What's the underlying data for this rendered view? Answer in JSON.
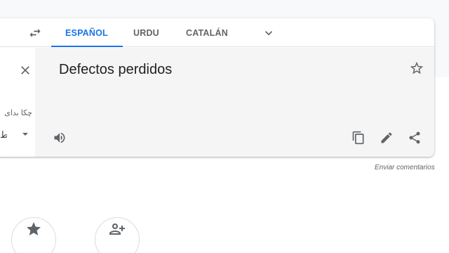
{
  "lang_tabs": [
    {
      "label": "ESPAÑOL",
      "active": true
    },
    {
      "label": "URDU",
      "active": false
    },
    {
      "label": "CATALÁN",
      "active": false
    }
  ],
  "source": {
    "text_fragment": "چکا بدای",
    "transliteration_fragment": "ط"
  },
  "translation": {
    "text": "Defectos perdidos"
  },
  "feedback_link": "Enviar comentarios",
  "icons": {
    "swap": "swap-languages-icon",
    "more_languages": "chevron-down-icon",
    "clear": "close-icon",
    "save": "star-outline-icon",
    "listen": "speaker-icon",
    "copy": "copy-icon",
    "edit": "pencil-icon",
    "share": "share-icon",
    "saved": "star-icon",
    "community": "community-icon"
  },
  "colors": {
    "accent": "#1a73e8",
    "icon": "#5f6368",
    "text": "#202124",
    "output_panel_bg": "#f5f5f5"
  }
}
